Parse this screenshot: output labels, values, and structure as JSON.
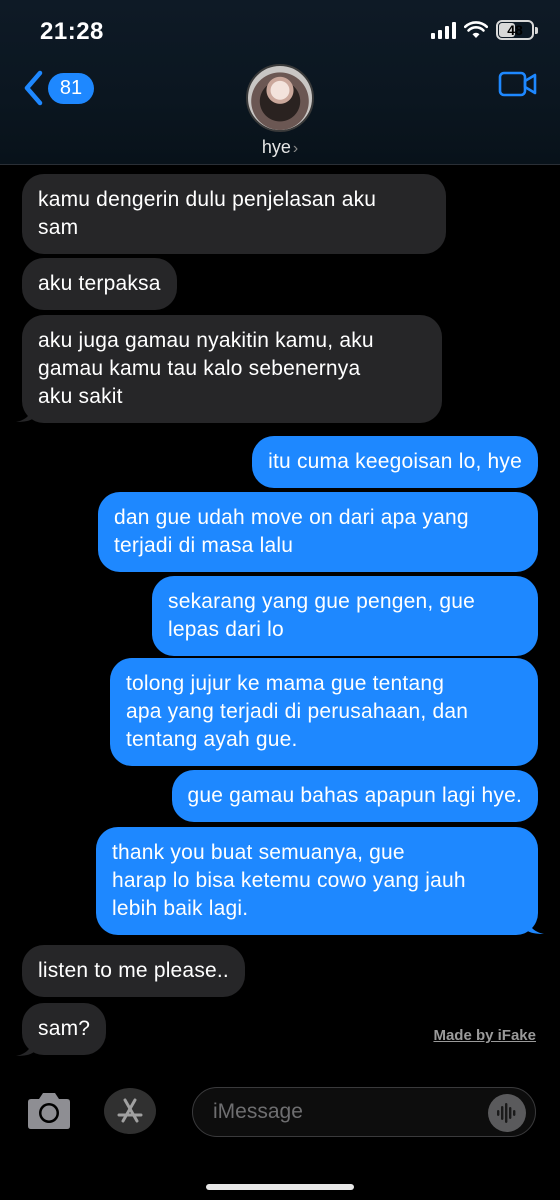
{
  "status_bar": {
    "time": "21:28",
    "battery": "48"
  },
  "header": {
    "back_count": "81",
    "contact_name": "hye",
    "chevron": "›"
  },
  "messages": [
    {
      "side": "in",
      "text": "kamu dengerin dulu penjelasan aku\nsam"
    },
    {
      "side": "in",
      "text": "aku terpaksa"
    },
    {
      "side": "in",
      "text": "aku juga gamau nyakitin kamu, aku\ngamau kamu tau kalo sebenernya\naku sakit"
    },
    {
      "side": "out",
      "text": "itu cuma keegoisan lo, hye"
    },
    {
      "side": "out",
      "text": "dan gue udah move on dari apa yang\nterjadi di masa lalu"
    },
    {
      "side": "out",
      "text": "sekarang yang gue pengen, gue\nlepas dari lo"
    },
    {
      "side": "out",
      "text": "tolong jujur ke mama gue tentang\napa yang terjadi di perusahaan, dan\ntentang ayah gue."
    },
    {
      "side": "out",
      "text": "gue gamau bahas apapun lagi hye."
    },
    {
      "side": "out",
      "text": "thank you buat semuanya, gue\nharap lo bisa ketemu cowo yang jauh\nlebih baik lagi."
    },
    {
      "side": "in",
      "text": "listen to me please.."
    },
    {
      "side": "in",
      "text": "sam?"
    }
  ],
  "watermark": "Made by iFake",
  "input": {
    "placeholder": "iMessage"
  },
  "colors": {
    "outgoing": "#1e88ff",
    "incoming": "#262628",
    "accent": "#1e88ff"
  },
  "icons": [
    "back-chevron-icon",
    "video-camera-icon",
    "camera-icon",
    "app-store-icon",
    "voice-waveform-icon"
  ]
}
